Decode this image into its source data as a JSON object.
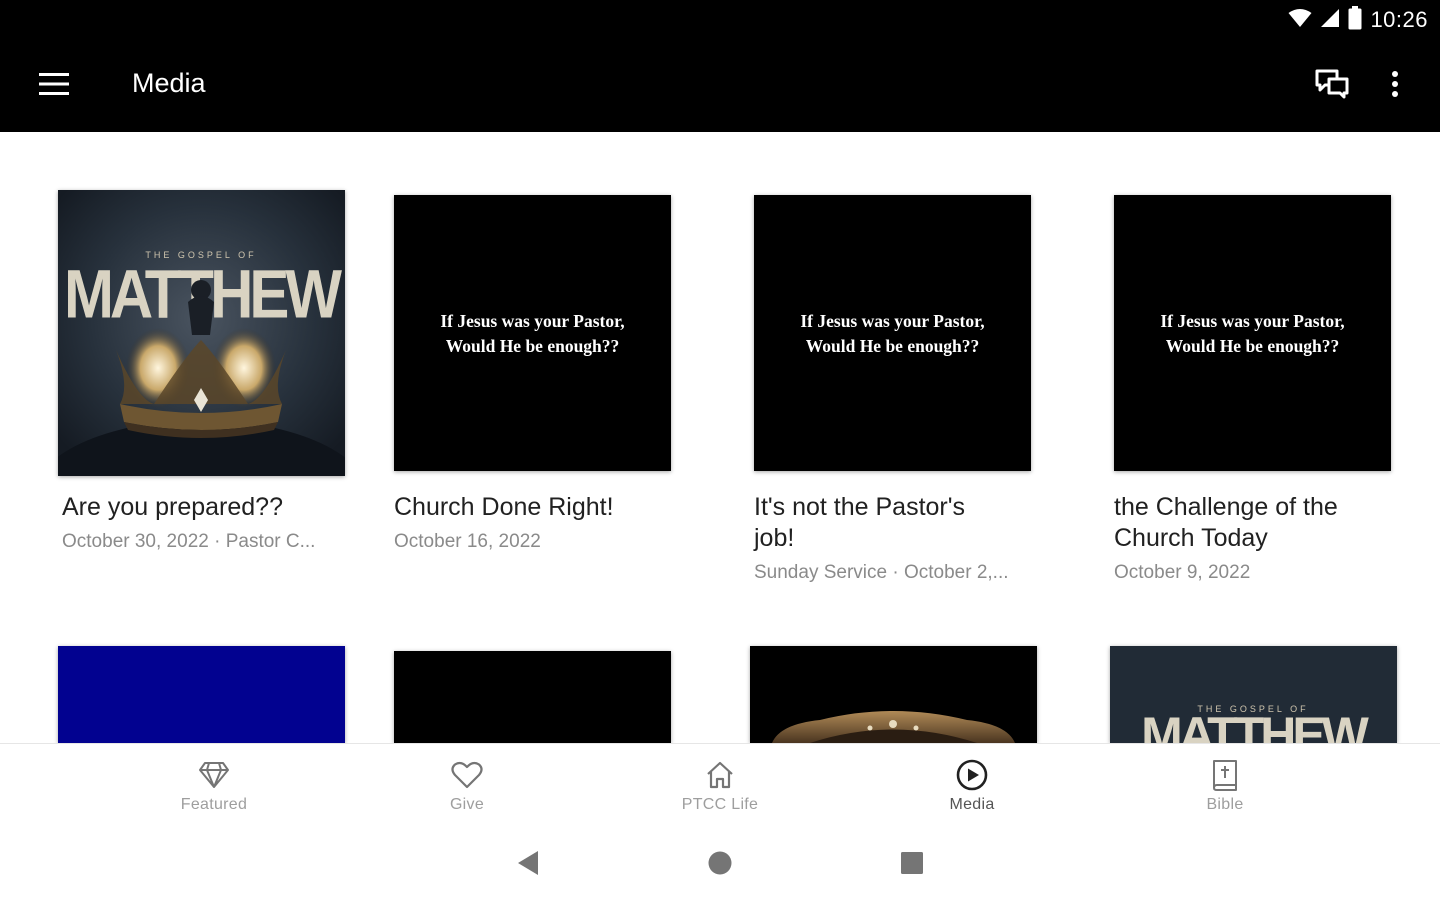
{
  "status_bar": {
    "time": "10:26"
  },
  "app_bar": {
    "title": "Media"
  },
  "pastor_slide": {
    "line1": "If Jesus was your Pastor,",
    "line2": "Would He be  enough??"
  },
  "matthew_art": {
    "small_text": "THE GOSPEL OF",
    "big_text": "MATTHEW"
  },
  "cards": [
    {
      "title": "Are you prepared??",
      "subtitle": "October 30, 2022 · Pastor C..."
    },
    {
      "title": "Church Done Right!",
      "subtitle": "October 16, 2022"
    },
    {
      "title": "It's not the Pastor's job!",
      "subtitle": "Sunday Service · October 2,..."
    },
    {
      "title": "the Challenge of the Church Today",
      "subtitle": "October 9, 2022"
    }
  ],
  "colors": {
    "bar_bg": "#000000",
    "blue_thumb": "#020290",
    "text_secondary": "#8a8a8a",
    "nav_label": "#9e9e9e"
  },
  "bottom_nav": {
    "items": [
      {
        "label": "Featured",
        "icon": "diamond-icon"
      },
      {
        "label": "Give",
        "icon": "heart-icon"
      },
      {
        "label": "PTCC Life",
        "icon": "home-icon"
      },
      {
        "label": "Media",
        "icon": "play-circle-icon",
        "active": true
      },
      {
        "label": "Bible",
        "icon": "bible-icon"
      }
    ]
  }
}
